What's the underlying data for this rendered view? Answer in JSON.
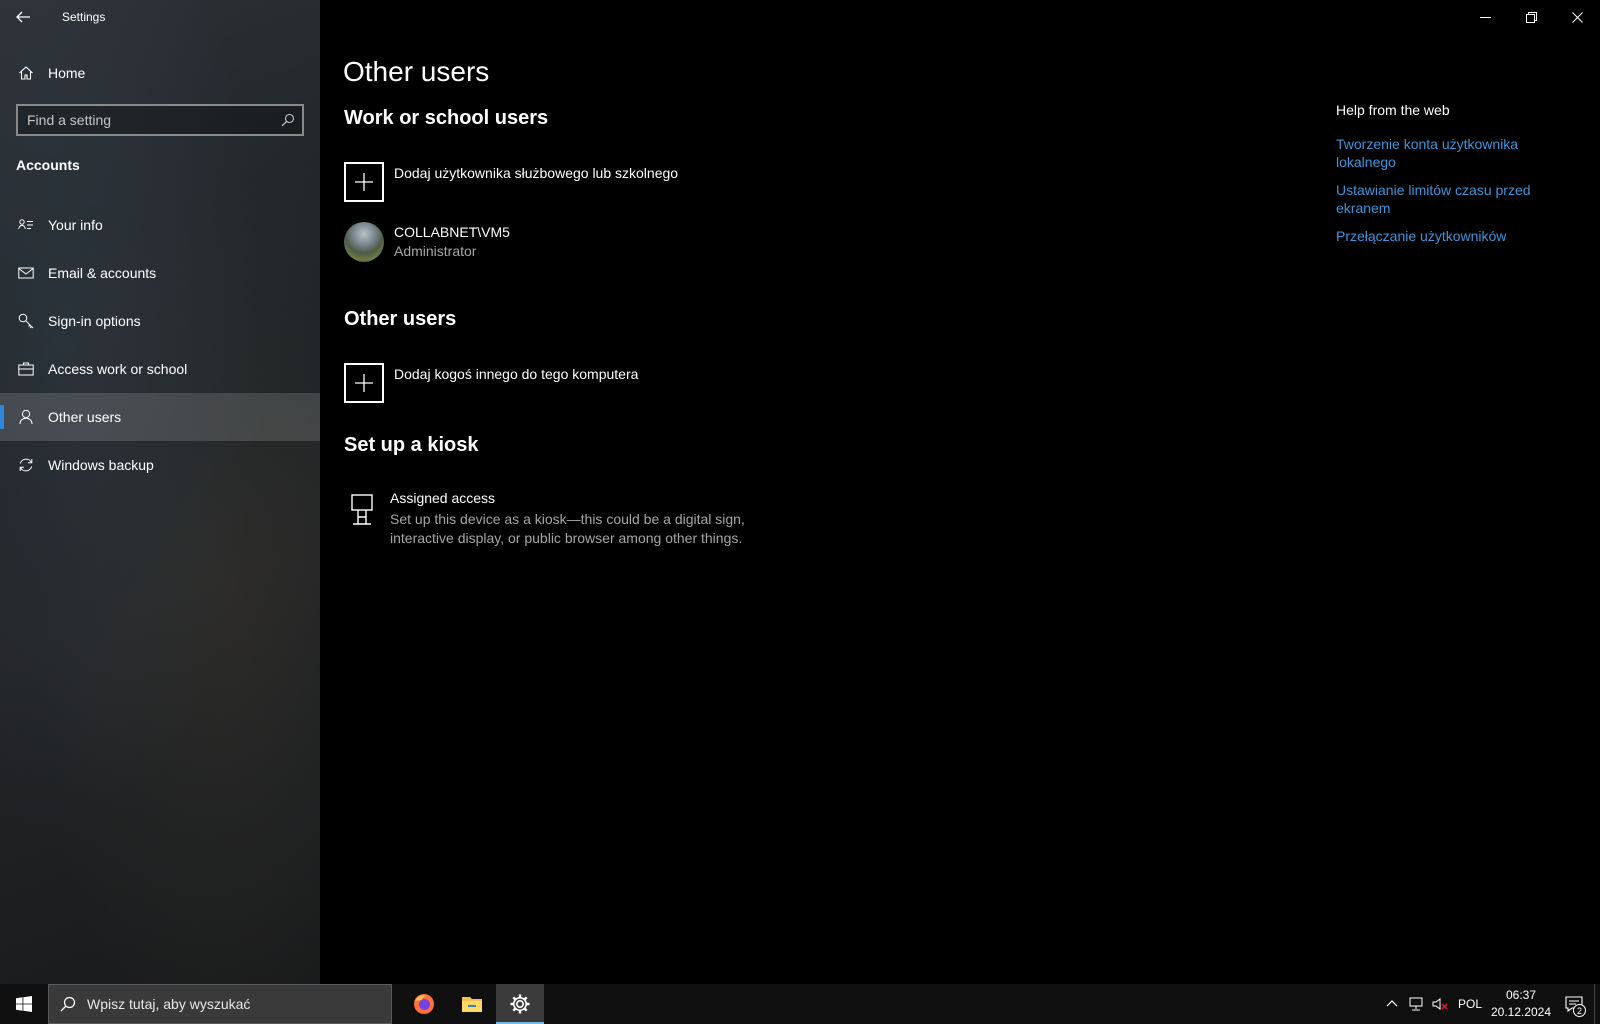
{
  "window": {
    "title": "Settings"
  },
  "sidebar": {
    "home_label": "Home",
    "search_placeholder": "Find a setting",
    "section_label": "Accounts",
    "items": [
      {
        "label": "Your info",
        "icon": "contact-card-icon"
      },
      {
        "label": "Email & accounts",
        "icon": "mail-icon"
      },
      {
        "label": "Sign-in options",
        "icon": "key-icon"
      },
      {
        "label": "Access work or school",
        "icon": "briefcase-icon"
      },
      {
        "label": "Other users",
        "icon": "person-icon",
        "active": true
      },
      {
        "label": "Windows backup",
        "icon": "sync-icon"
      }
    ]
  },
  "main": {
    "page_title": "Other users",
    "work_school": {
      "heading": "Work or school users",
      "add_label": "Dodaj użytkownika służbowego lub szkolnego",
      "user": {
        "name": "COLLABNET\\VM5",
        "role": "Administrator"
      }
    },
    "other_users": {
      "heading": "Other users",
      "add_label": "Dodaj kogoś innego do tego komputera"
    },
    "kiosk": {
      "heading": "Set up a kiosk",
      "title": "Assigned access",
      "description": "Set up this device as a kiosk—this could be a digital sign, interactive display, or public browser among other things."
    },
    "help": {
      "title": "Help from the web",
      "links": [
        "Tworzenie konta użytkownika lokalnego",
        "Ustawianie limitów czasu przed ekranem",
        "Przełączanie użytkowników"
      ]
    }
  },
  "taskbar": {
    "search_placeholder": "Wpisz tutaj, aby wyszukać",
    "language": "POL",
    "time": "06:37",
    "date": "20.12.2024",
    "notification_count": "2"
  },
  "colors": {
    "accent": "#2b88d8",
    "link": "#3a96dd",
    "background": "#000000",
    "taskbar": "#101010"
  }
}
